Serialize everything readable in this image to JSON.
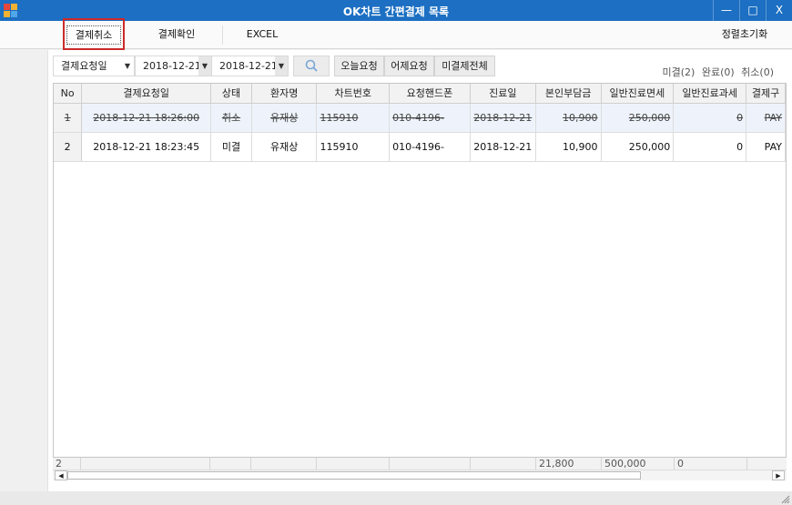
{
  "window": {
    "title": "OK차트 간편결제 목록",
    "minimize": "—",
    "maximize": "□",
    "close": "X"
  },
  "toolbar": {
    "cancel_label": "결제취소",
    "confirm_label": "결제확인",
    "excel_label": "EXCEL",
    "reset_label": "정렬초기화"
  },
  "filter": {
    "date_type": "결제요청일",
    "from_date": "2018-12-21",
    "to_date": "2018-12-21",
    "search_icon": "magnifier-icon",
    "today_label": "오늘요청",
    "yesterday_label": "어제요청",
    "unpaid_all_label": "미결제전체"
  },
  "summary": {
    "unpaid": "미결(2)",
    "completed": "완료(0)",
    "cancelled": "취소(0)"
  },
  "grid": {
    "headers": [
      "No",
      "결제요청일",
      "상태",
      "환자명",
      "차트번호",
      "요청핸드폰",
      "진료일",
      "본인부담금",
      "일반진료면세",
      "일반진료과세",
      "결제구"
    ],
    "rows": [
      {
        "no": "1",
        "requested": "2018-12-21  18:26:00",
        "status": "취소",
        "patient": "유재상",
        "chart": "115910",
        "phone": "010-4196-",
        "visit": "2018-12-21",
        "copay": "10,900",
        "exempt": "250,000",
        "taxable": "0",
        "method": "PAY"
      },
      {
        "no": "2",
        "requested": "2018-12-21 18:23:45",
        "status": "미결",
        "patient": "유재상",
        "chart": "115910",
        "phone": "010-4196-",
        "visit": "2018-12-21",
        "copay": "10,900",
        "exempt": "250,000",
        "taxable": "0",
        "method": "PAY"
      }
    ],
    "totals": {
      "count": "2",
      "copay": "21,800",
      "exempt": "500,000",
      "taxable": "0"
    }
  },
  "colors": {
    "titlebar": "#1c6fc2",
    "highlight": "#cc2a2a",
    "unpaid_status": "#e06c1f",
    "selected_row": "#eef3fb"
  }
}
